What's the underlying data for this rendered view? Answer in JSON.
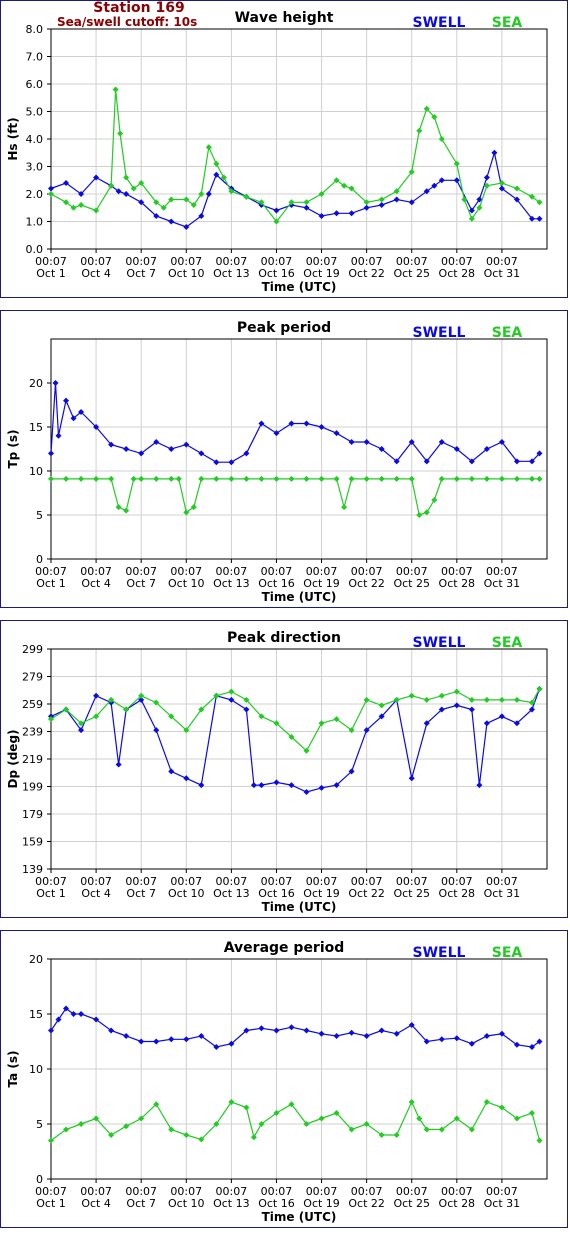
{
  "header": {
    "station": "Station 169",
    "cutoff": "Sea/swell cutoff: 10s"
  },
  "colors": {
    "swell": "#0a0ae6",
    "sea": "#22cc22",
    "frame": "#1a1a80",
    "grid": "#d0d0d0",
    "header": "#8b0000"
  },
  "chart_data": [
    {
      "type": "line",
      "title": "Wave height",
      "xlabel": "Time (UTC)",
      "ylabel": "Hs (ft)",
      "ylim": [
        0,
        8
      ],
      "yticks": [
        "0.0",
        "1.0",
        "2.0",
        "3.0",
        "4.0",
        "5.0",
        "6.0",
        "7.0",
        "8.0"
      ],
      "xticks": [
        [
          "00:07",
          "Oct 1"
        ],
        [
          "00:07",
          "Oct 4"
        ],
        [
          "00:07",
          "Oct 7"
        ],
        [
          "00:07",
          "Oct 10"
        ],
        [
          "00:07",
          "Oct 13"
        ],
        [
          "00:07",
          "Oct 16"
        ],
        [
          "00:07",
          "Oct 19"
        ],
        [
          "00:07",
          "Oct 22"
        ],
        [
          "00:07",
          "Oct 25"
        ],
        [
          "00:07",
          "Oct 28"
        ],
        [
          "00:07",
          "Oct 31"
        ]
      ],
      "grid": true,
      "legend": "top-right",
      "series": [
        {
          "name": "SWELL",
          "color": "#0a0ae6",
          "x": [
            0,
            1,
            2,
            3,
            4,
            4.5,
            5,
            6,
            7,
            8,
            9,
            10,
            10.5,
            11,
            12,
            13,
            14,
            15,
            16,
            17,
            18,
            19,
            20,
            21,
            22,
            23,
            24,
            25,
            25.5,
            26,
            27,
            28,
            28.5,
            29,
            29.5,
            30,
            31,
            32,
            32.5
          ],
          "values": [
            2.2,
            2.4,
            2.0,
            2.6,
            2.3,
            2.1,
            2.0,
            1.7,
            1.2,
            1.0,
            0.8,
            1.2,
            2.0,
            2.7,
            2.2,
            1.9,
            1.6,
            1.4,
            1.6,
            1.5,
            1.2,
            1.3,
            1.3,
            1.5,
            1.6,
            1.8,
            1.7,
            2.1,
            2.3,
            2.5,
            2.5,
            1.4,
            1.8,
            2.6,
            3.5,
            2.2,
            1.8,
            1.1,
            1.1
          ]
        },
        {
          "name": "SEA",
          "color": "#22cc22",
          "x": [
            0,
            1,
            1.5,
            2,
            3,
            4,
            4.3,
            4.6,
            5,
            5.5,
            6,
            7,
            7.5,
            8,
            9,
            9.5,
            10,
            10.5,
            11,
            11.5,
            12,
            13,
            14,
            15,
            16,
            17,
            18,
            19,
            19.5,
            20,
            21,
            22,
            23,
            24,
            24.5,
            25,
            25.5,
            26,
            27,
            27.5,
            28,
            28.5,
            29,
            30,
            31,
            32,
            32.5
          ],
          "values": [
            2.0,
            1.7,
            1.5,
            1.6,
            1.4,
            2.3,
            5.8,
            4.2,
            2.6,
            2.2,
            2.4,
            1.7,
            1.5,
            1.8,
            1.8,
            1.6,
            2.0,
            3.7,
            3.1,
            2.6,
            2.1,
            1.9,
            1.7,
            1.0,
            1.7,
            1.7,
            2.0,
            2.5,
            2.3,
            2.2,
            1.7,
            1.8,
            2.1,
            2.8,
            4.3,
            5.1,
            4.8,
            4.0,
            3.1,
            1.8,
            1.1,
            1.5,
            2.3,
            2.4,
            2.2,
            1.9,
            1.7
          ]
        }
      ]
    },
    {
      "type": "line",
      "title": "Peak period",
      "xlabel": "Time (UTC)",
      "ylabel": "Tp (s)",
      "ylim": [
        0,
        25
      ],
      "yticks": [
        "0",
        "5",
        "10",
        "15",
        "20"
      ],
      "ytick_values": [
        0,
        5,
        10,
        15,
        20
      ],
      "xticks": [
        [
          "00:07",
          "Oct 1"
        ],
        [
          "00:07",
          "Oct 4"
        ],
        [
          "00:07",
          "Oct 7"
        ],
        [
          "00:07",
          "Oct 10"
        ],
        [
          "00:07",
          "Oct 13"
        ],
        [
          "00:07",
          "Oct 16"
        ],
        [
          "00:07",
          "Oct 19"
        ],
        [
          "00:07",
          "Oct 22"
        ],
        [
          "00:07",
          "Oct 25"
        ],
        [
          "00:07",
          "Oct 28"
        ],
        [
          "00:07",
          "Oct 31"
        ]
      ],
      "grid": true,
      "legend": "top-right",
      "series": [
        {
          "name": "SWELL",
          "color": "#0a0ae6",
          "x": [
            0,
            0.3,
            0.5,
            1,
            1.5,
            2,
            3,
            4,
            5,
            6,
            7,
            8,
            9,
            10,
            11,
            12,
            13,
            14,
            15,
            16,
            17,
            18,
            19,
            20,
            21,
            22,
            23,
            24,
            25,
            26,
            27,
            28,
            29,
            30,
            31,
            32,
            32.5
          ],
          "values": [
            12,
            20,
            14,
            18,
            16,
            16.7,
            15,
            13,
            12.5,
            12,
            13.3,
            12.5,
            13,
            12,
            11,
            11,
            12,
            15.4,
            14.3,
            15.4,
            15.4,
            15,
            14.3,
            13.3,
            13.3,
            12.5,
            11.1,
            13.3,
            11.1,
            13.3,
            12.5,
            11.1,
            12.5,
            13.3,
            11.1,
            11.1,
            12
          ]
        },
        {
          "name": "SEA",
          "color": "#22cc22",
          "x": [
            0,
            1,
            2,
            3,
            4,
            4.5,
            5,
            5.5,
            6,
            7,
            8,
            8.5,
            9,
            9.5,
            10,
            11,
            12,
            13,
            14,
            15,
            16,
            17,
            18,
            19,
            19.5,
            20,
            21,
            22,
            23,
            24,
            24.5,
            25,
            25.5,
            26,
            27,
            28,
            29,
            30,
            31,
            32,
            32.5
          ],
          "values": [
            9.1,
            9.1,
            9.1,
            9.1,
            9.1,
            5.9,
            5.5,
            9.1,
            9.1,
            9.1,
            9.1,
            9.1,
            5.3,
            5.9,
            9.1,
            9.1,
            9.1,
            9.1,
            9.1,
            9.1,
            9.1,
            9.1,
            9.1,
            9.1,
            5.9,
            9.1,
            9.1,
            9.1,
            9.1,
            9.1,
            5.0,
            5.3,
            6.7,
            9.1,
            9.1,
            9.1,
            9.1,
            9.1,
            9.1,
            9.1,
            9.1
          ]
        }
      ]
    },
    {
      "type": "line",
      "title": "Peak direction",
      "xlabel": "Time (UTC)",
      "ylabel": "Dp (deg)",
      "ylim": [
        139,
        299
      ],
      "yticks": [
        "139",
        "159",
        "179",
        "199",
        "219",
        "239",
        "259",
        "279",
        "299"
      ],
      "ytick_values": [
        139,
        159,
        179,
        199,
        219,
        239,
        259,
        279,
        299
      ],
      "xticks": [
        [
          "00:07",
          "Oct 1"
        ],
        [
          "00:07",
          "Oct 4"
        ],
        [
          "00:07",
          "Oct 7"
        ],
        [
          "00:07",
          "Oct 10"
        ],
        [
          "00:07",
          "Oct 13"
        ],
        [
          "00:07",
          "Oct 16"
        ],
        [
          "00:07",
          "Oct 19"
        ],
        [
          "00:07",
          "Oct 22"
        ],
        [
          "00:07",
          "Oct 25"
        ],
        [
          "00:07",
          "Oct 28"
        ],
        [
          "00:07",
          "Oct 31"
        ]
      ],
      "grid": true,
      "legend": "top-right",
      "series": [
        {
          "name": "SWELL",
          "color": "#0a0ae6",
          "x": [
            0,
            1,
            2,
            3,
            4,
            4.5,
            5,
            6,
            7,
            8,
            9,
            10,
            11,
            12,
            13,
            13.5,
            14,
            15,
            16,
            17,
            18,
            19,
            20,
            21,
            22,
            23,
            24,
            25,
            26,
            27,
            28,
            28.5,
            29,
            30,
            31,
            32,
            32.5
          ],
          "values": [
            250,
            255,
            240,
            265,
            260,
            215,
            255,
            262,
            240,
            210,
            205,
            200,
            265,
            262,
            255,
            200,
            200,
            202,
            200,
            195,
            198,
            200,
            210,
            240,
            250,
            262,
            205,
            245,
            255,
            258,
            255,
            200,
            245,
            250,
            245,
            255,
            270
          ]
        },
        {
          "name": "SEA",
          "color": "#22cc22",
          "x": [
            0,
            1,
            2,
            3,
            4,
            5,
            6,
            7,
            8,
            9,
            10,
            11,
            12,
            13,
            14,
            15,
            16,
            17,
            18,
            19,
            20,
            21,
            22,
            23,
            24,
            25,
            26,
            27,
            28,
            29,
            30,
            31,
            32,
            32.5
          ],
          "values": [
            248,
            255,
            245,
            250,
            262,
            255,
            265,
            260,
            250,
            240,
            255,
            265,
            268,
            262,
            250,
            245,
            235,
            225,
            245,
            248,
            240,
            262,
            258,
            262,
            265,
            262,
            265,
            268,
            262,
            262,
            262,
            262,
            260,
            270
          ]
        }
      ]
    },
    {
      "type": "line",
      "title": "Average period",
      "xlabel": "Time (UTC)",
      "ylabel": "Ta (s)",
      "ylim": [
        0,
        20
      ],
      "yticks": [
        "0",
        "5",
        "10",
        "15",
        "20"
      ],
      "ytick_values": [
        0,
        5,
        10,
        15,
        20
      ],
      "xticks": [
        [
          "00:07",
          "Oct 1"
        ],
        [
          "00:07",
          "Oct 4"
        ],
        [
          "00:07",
          "Oct 7"
        ],
        [
          "00:07",
          "Oct 10"
        ],
        [
          "00:07",
          "Oct 13"
        ],
        [
          "00:07",
          "Oct 16"
        ],
        [
          "00:07",
          "Oct 19"
        ],
        [
          "00:07",
          "Oct 22"
        ],
        [
          "00:07",
          "Oct 25"
        ],
        [
          "00:07",
          "Oct 28"
        ],
        [
          "00:07",
          "Oct 31"
        ]
      ],
      "grid": true,
      "legend": "top-right",
      "series": [
        {
          "name": "SWELL",
          "color": "#0a0ae6",
          "x": [
            0,
            0.5,
            1,
            1.5,
            2,
            3,
            4,
            5,
            6,
            7,
            8,
            9,
            10,
            11,
            12,
            13,
            14,
            15,
            16,
            17,
            18,
            19,
            20,
            21,
            22,
            23,
            24,
            25,
            26,
            27,
            28,
            29,
            30,
            31,
            32,
            32.5
          ],
          "values": [
            13.5,
            14.5,
            15.5,
            15.0,
            15.0,
            14.5,
            13.5,
            13.0,
            12.5,
            12.5,
            12.7,
            12.7,
            13.0,
            12.0,
            12.3,
            13.5,
            13.7,
            13.5,
            13.8,
            13.5,
            13.2,
            13.0,
            13.3,
            13.0,
            13.5,
            13.2,
            14.0,
            12.5,
            12.7,
            12.8,
            12.3,
            13.0,
            13.2,
            12.2,
            12.0,
            12.5
          ]
        },
        {
          "name": "SEA",
          "color": "#22cc22",
          "x": [
            0,
            1,
            2,
            3,
            4,
            5,
            6,
            7,
            8,
            9,
            10,
            11,
            12,
            13,
            13.5,
            14,
            15,
            16,
            17,
            18,
            19,
            20,
            21,
            22,
            23,
            24,
            24.5,
            25,
            26,
            27,
            28,
            29,
            30,
            31,
            32,
            32.5
          ],
          "values": [
            3.5,
            4.5,
            5.0,
            5.5,
            4.0,
            4.8,
            5.5,
            6.8,
            4.5,
            4.0,
            3.6,
            5.0,
            7.0,
            6.5,
            3.8,
            5.0,
            6.0,
            6.8,
            5.0,
            5.5,
            6.0,
            4.5,
            5.0,
            4.0,
            4.0,
            7.0,
            5.5,
            4.5,
            4.5,
            5.5,
            4.5,
            7.0,
            6.5,
            5.5,
            6.0,
            3.5
          ]
        }
      ]
    }
  ]
}
